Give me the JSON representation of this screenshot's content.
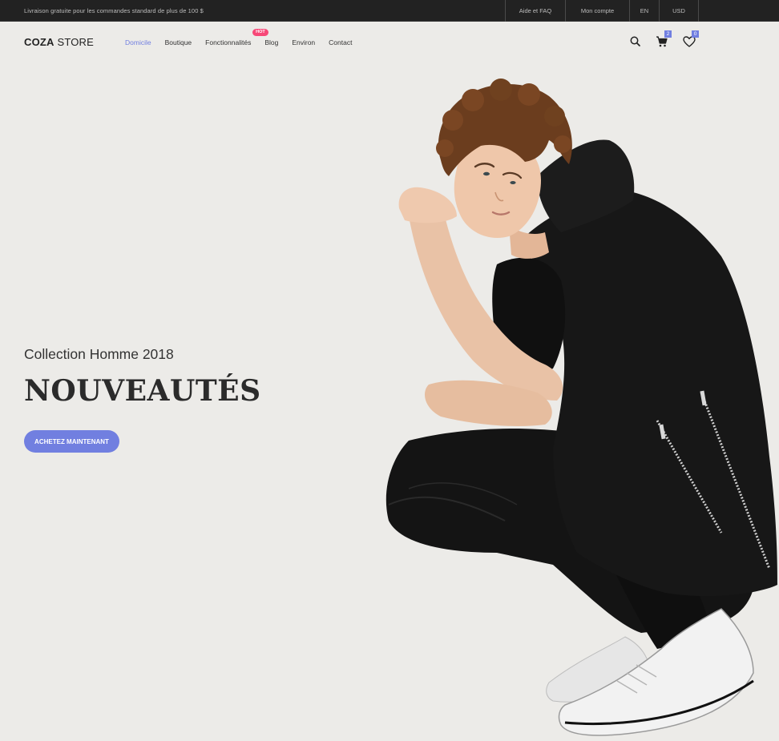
{
  "topbar": {
    "message": "Livraison gratuite pour les commandes standard de plus de 100 $",
    "links": [
      "Aide et FAQ",
      "Mon compte",
      "EN",
      "USD"
    ]
  },
  "header": {
    "logo_bold": "COZA",
    "logo_light": " STORE",
    "nav": [
      "Domicile",
      "Boutique",
      "Fonctionnalités",
      "Blog",
      "Environ",
      "Contact"
    ],
    "active_nav": "Domicile",
    "hot_badge": "HOT",
    "cart_count": "2",
    "wishlist_count": "0"
  },
  "icons": {
    "search": "search-icon",
    "cart": "cart-icon",
    "wishlist": "heart-icon"
  },
  "hero": {
    "subtitle": "Collection Homme 2018",
    "title": "NOUVEAUTÉS",
    "button": "ACHETEZ MAINTENANT"
  },
  "colors": {
    "accent": "#717fe0",
    "hot": "#f74877",
    "topbar": "#222222",
    "background": "#ecebe8"
  }
}
